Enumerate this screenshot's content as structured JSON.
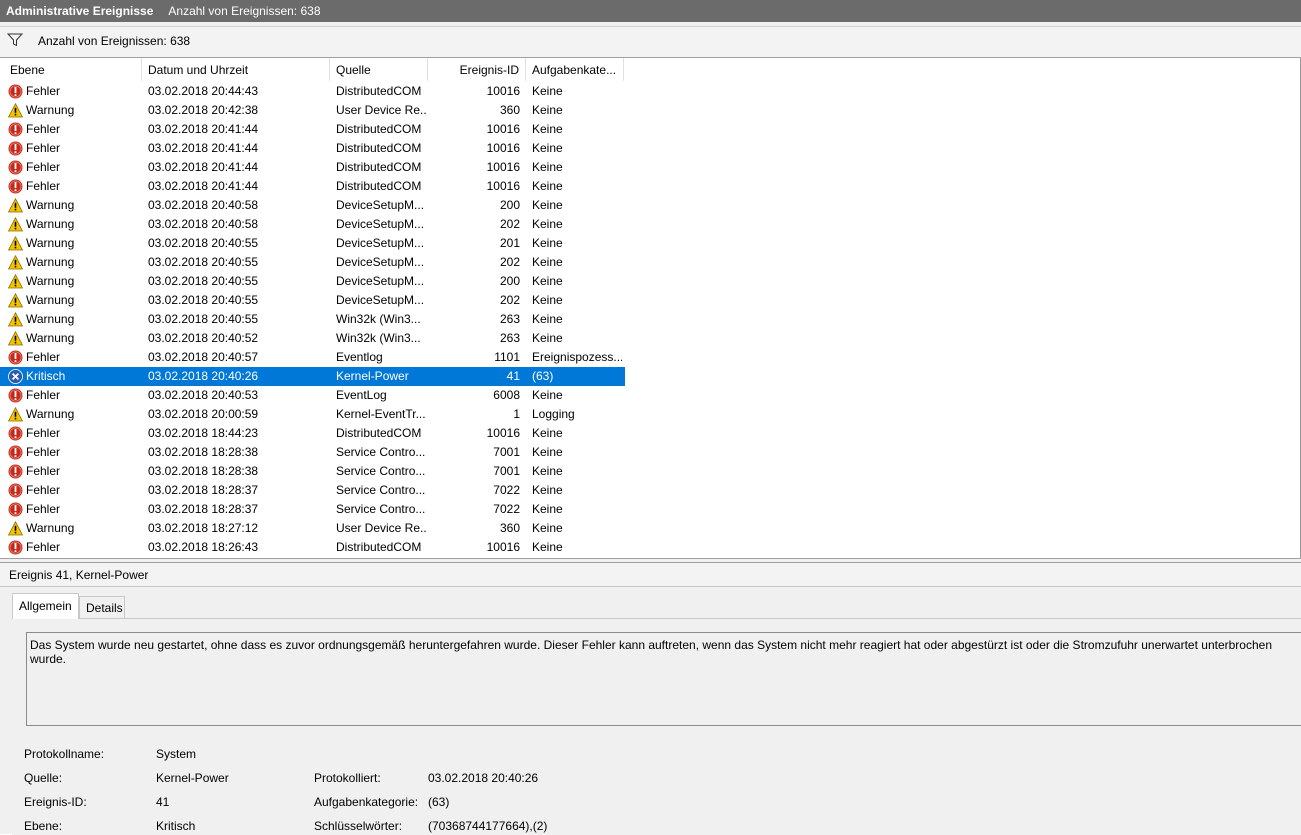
{
  "titlebar": {
    "title": "Administrative Ereignisse",
    "count": "Anzahl von Ereignissen: 638"
  },
  "filterbar": {
    "text": "Anzahl von Ereignissen: 638"
  },
  "columns": {
    "level": "Ebene",
    "datetime": "Datum und Uhrzeit",
    "source": "Quelle",
    "id": "Ereignis-ID",
    "category": "Aufgabenkate..."
  },
  "events": [
    {
      "level": "Fehler",
      "type": "error",
      "date": "03.02.2018 20:44:43",
      "source": "DistributedCOM",
      "id": "10016",
      "category": "Keine"
    },
    {
      "level": "Warnung",
      "type": "warning",
      "date": "03.02.2018 20:42:38",
      "source": "User Device Re...",
      "id": "360",
      "category": "Keine"
    },
    {
      "level": "Fehler",
      "type": "error",
      "date": "03.02.2018 20:41:44",
      "source": "DistributedCOM",
      "id": "10016",
      "category": "Keine"
    },
    {
      "level": "Fehler",
      "type": "error",
      "date": "03.02.2018 20:41:44",
      "source": "DistributedCOM",
      "id": "10016",
      "category": "Keine"
    },
    {
      "level": "Fehler",
      "type": "error",
      "date": "03.02.2018 20:41:44",
      "source": "DistributedCOM",
      "id": "10016",
      "category": "Keine"
    },
    {
      "level": "Fehler",
      "type": "error",
      "date": "03.02.2018 20:41:44",
      "source": "DistributedCOM",
      "id": "10016",
      "category": "Keine"
    },
    {
      "level": "Warnung",
      "type": "warning",
      "date": "03.02.2018 20:40:58",
      "source": "DeviceSetupM...",
      "id": "200",
      "category": "Keine"
    },
    {
      "level": "Warnung",
      "type": "warning",
      "date": "03.02.2018 20:40:58",
      "source": "DeviceSetupM...",
      "id": "202",
      "category": "Keine"
    },
    {
      "level": "Warnung",
      "type": "warning",
      "date": "03.02.2018 20:40:55",
      "source": "DeviceSetupM...",
      "id": "201",
      "category": "Keine"
    },
    {
      "level": "Warnung",
      "type": "warning",
      "date": "03.02.2018 20:40:55",
      "source": "DeviceSetupM...",
      "id": "202",
      "category": "Keine"
    },
    {
      "level": "Warnung",
      "type": "warning",
      "date": "03.02.2018 20:40:55",
      "source": "DeviceSetupM...",
      "id": "200",
      "category": "Keine"
    },
    {
      "level": "Warnung",
      "type": "warning",
      "date": "03.02.2018 20:40:55",
      "source": "DeviceSetupM...",
      "id": "202",
      "category": "Keine"
    },
    {
      "level": "Warnung",
      "type": "warning",
      "date": "03.02.2018 20:40:55",
      "source": "Win32k (Win3...",
      "id": "263",
      "category": "Keine"
    },
    {
      "level": "Warnung",
      "type": "warning",
      "date": "03.02.2018 20:40:52",
      "source": "Win32k (Win3...",
      "id": "263",
      "category": "Keine"
    },
    {
      "level": "Fehler",
      "type": "error",
      "date": "03.02.2018 20:40:57",
      "source": "Eventlog",
      "id": "1101",
      "category": "Ereignispozess..."
    },
    {
      "level": "Kritisch",
      "type": "critical",
      "date": "03.02.2018 20:40:26",
      "source": "Kernel-Power",
      "id": "41",
      "category": "(63)",
      "selected": true
    },
    {
      "level": "Fehler",
      "type": "error",
      "date": "03.02.2018 20:40:53",
      "source": "EventLog",
      "id": "6008",
      "category": "Keine"
    },
    {
      "level": "Warnung",
      "type": "warning",
      "date": "03.02.2018 20:00:59",
      "source": "Kernel-EventTr...",
      "id": "1",
      "category": "Logging"
    },
    {
      "level": "Fehler",
      "type": "error",
      "date": "03.02.2018 18:44:23",
      "source": "DistributedCOM",
      "id": "10016",
      "category": "Keine"
    },
    {
      "level": "Fehler",
      "type": "error",
      "date": "03.02.2018 18:28:38",
      "source": "Service Contro...",
      "id": "7001",
      "category": "Keine"
    },
    {
      "level": "Fehler",
      "type": "error",
      "date": "03.02.2018 18:28:38",
      "source": "Service Contro...",
      "id": "7001",
      "category": "Keine"
    },
    {
      "level": "Fehler",
      "type": "error",
      "date": "03.02.2018 18:28:37",
      "source": "Service Contro...",
      "id": "7022",
      "category": "Keine"
    },
    {
      "level": "Fehler",
      "type": "error",
      "date": "03.02.2018 18:28:37",
      "source": "Service Contro...",
      "id": "7022",
      "category": "Keine"
    },
    {
      "level": "Warnung",
      "type": "warning",
      "date": "03.02.2018 18:27:12",
      "source": "User Device Re...",
      "id": "360",
      "category": "Keine"
    },
    {
      "level": "Fehler",
      "type": "error",
      "date": "03.02.2018 18:26:43",
      "source": "DistributedCOM",
      "id": "10016",
      "category": "Keine"
    }
  ],
  "detail": {
    "title": "Ereignis 41, Kernel-Power",
    "tabs": {
      "general": "Allgemein",
      "details": "Details"
    },
    "description": "Das System wurde neu gestartet, ohne dass es zuvor ordnungsgemäß heruntergefahren wurde. Dieser Fehler kann auftreten, wenn das System nicht mehr reagiert hat oder abgestürzt ist oder die Stromzufuhr unerwartet unterbrochen wurde.",
    "fields": {
      "logname_label": "Protokollname:",
      "logname": "System",
      "source_label": "Quelle:",
      "source": "Kernel-Power",
      "logged_label": "Protokolliert:",
      "logged": "03.02.2018 20:40:26",
      "id_label": "Ereignis-ID:",
      "id": "41",
      "category_label": "Aufgabenkategorie:",
      "category": "(63)",
      "level_label": "Ebene:",
      "level": "Kritisch",
      "keywords_label": "Schlüsselwörter:",
      "keywords": "(70368744177664),(2)"
    }
  },
  "colors": {
    "selection": "#0078d7",
    "error": "#c42b1c",
    "warning": "#f4c400",
    "critical": "#2a5db0",
    "titlebar": "#6b6b6b"
  },
  "icons": {
    "error": "error-icon",
    "warning": "warning-icon",
    "critical": "critical-icon",
    "filter": "filter-icon"
  }
}
